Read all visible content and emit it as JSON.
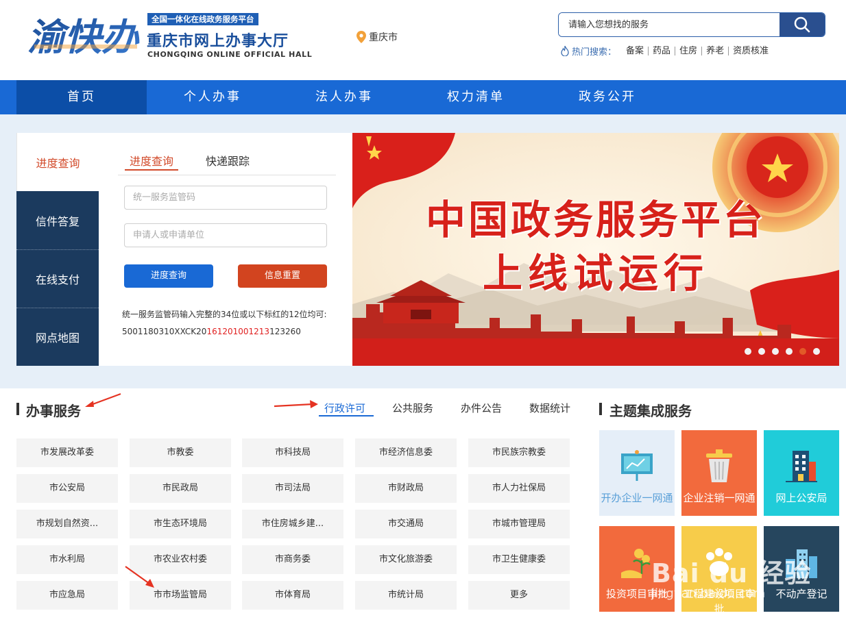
{
  "header": {
    "logo_text": "渝快办",
    "badge": "全国一体化在线政务服务平台",
    "title": "重庆市网上办事大厅",
    "subtitle": "CHONGQING ONLINE OFFICIAL HALL",
    "location": "重庆市",
    "search_placeholder": "请输入您想找的服务",
    "hot_label": "热门搜索：",
    "hot_items": [
      "备案",
      "药品",
      "住房",
      "养老",
      "资质核准"
    ]
  },
  "nav": [
    "首页",
    "个人办事",
    "法人办事",
    "权力清单",
    "政务公开"
  ],
  "query": {
    "side_tabs": [
      "进度查询",
      "信件答复",
      "在线支付",
      "网点地图"
    ],
    "tabs": [
      "进度查询",
      "快递跟踪"
    ],
    "code_placeholder": "统一服务监管码",
    "applicant_placeholder": "申请人或申请单位",
    "submit_label": "进度查询",
    "reset_label": "信息重置",
    "note": "统一服务监管码输入完整的34位或以下标红的12位均可:",
    "code_prefix": "5001180310XXCK20",
    "code_red": "161201001213",
    "code_suffix": "123260"
  },
  "banner": {
    "line1": "中国政务服务平台",
    "line2": "上线试运行",
    "slide_count": 6,
    "active_slide": 5
  },
  "services": {
    "title": "办事服务",
    "tabs": [
      "行政许可",
      "公共服务",
      "办件公告",
      "数据统计"
    ],
    "departments": [
      [
        "市发展改革委",
        "市教委",
        "市科技局",
        "市经济信息委",
        "市民族宗教委"
      ],
      [
        "市公安局",
        "市民政局",
        "市司法局",
        "市财政局",
        "市人力社保局"
      ],
      [
        "市规划自然资...",
        "市生态环境局",
        "市住房城乡建...",
        "市交通局",
        "市城市管理局"
      ],
      [
        "市水利局",
        "市农业农村委",
        "市商务委",
        "市文化旅游委",
        "市卫生健康委"
      ],
      [
        "市应急局",
        "市市场监管局",
        "市体育局",
        "市统计局",
        "更多"
      ]
    ]
  },
  "themes": {
    "title": "主题集成服务",
    "items": [
      {
        "label": "开办企业一网通",
        "bg": "#e5eef8",
        "fg": "#5aa0d8"
      },
      {
        "label": "企业注销一网通",
        "bg": "#f26a3d",
        "fg": "#ffffff"
      },
      {
        "label": "网上公安局",
        "bg": "#20ccd9",
        "fg": "#ffffff"
      },
      {
        "label": "投资项目审批",
        "bg": "#f26a3d",
        "fg": "#ffffff"
      },
      {
        "label": "工程建设项目审批",
        "bg": "#f7cc4a",
        "fg": "#ffffff"
      },
      {
        "label": "不动产登记",
        "bg": "#26465e",
        "fg": "#ffffff"
      }
    ]
  },
  "watermark": {
    "text": "Bai du 经验",
    "url": "jingyan.baidu.com"
  },
  "colors": {
    "nav_blue": "#1969d5",
    "nav_active": "#0c4ea7",
    "side_navy": "#1b3a5e",
    "accent_red": "#d24a2a",
    "button_blue": "#1969d5"
  }
}
